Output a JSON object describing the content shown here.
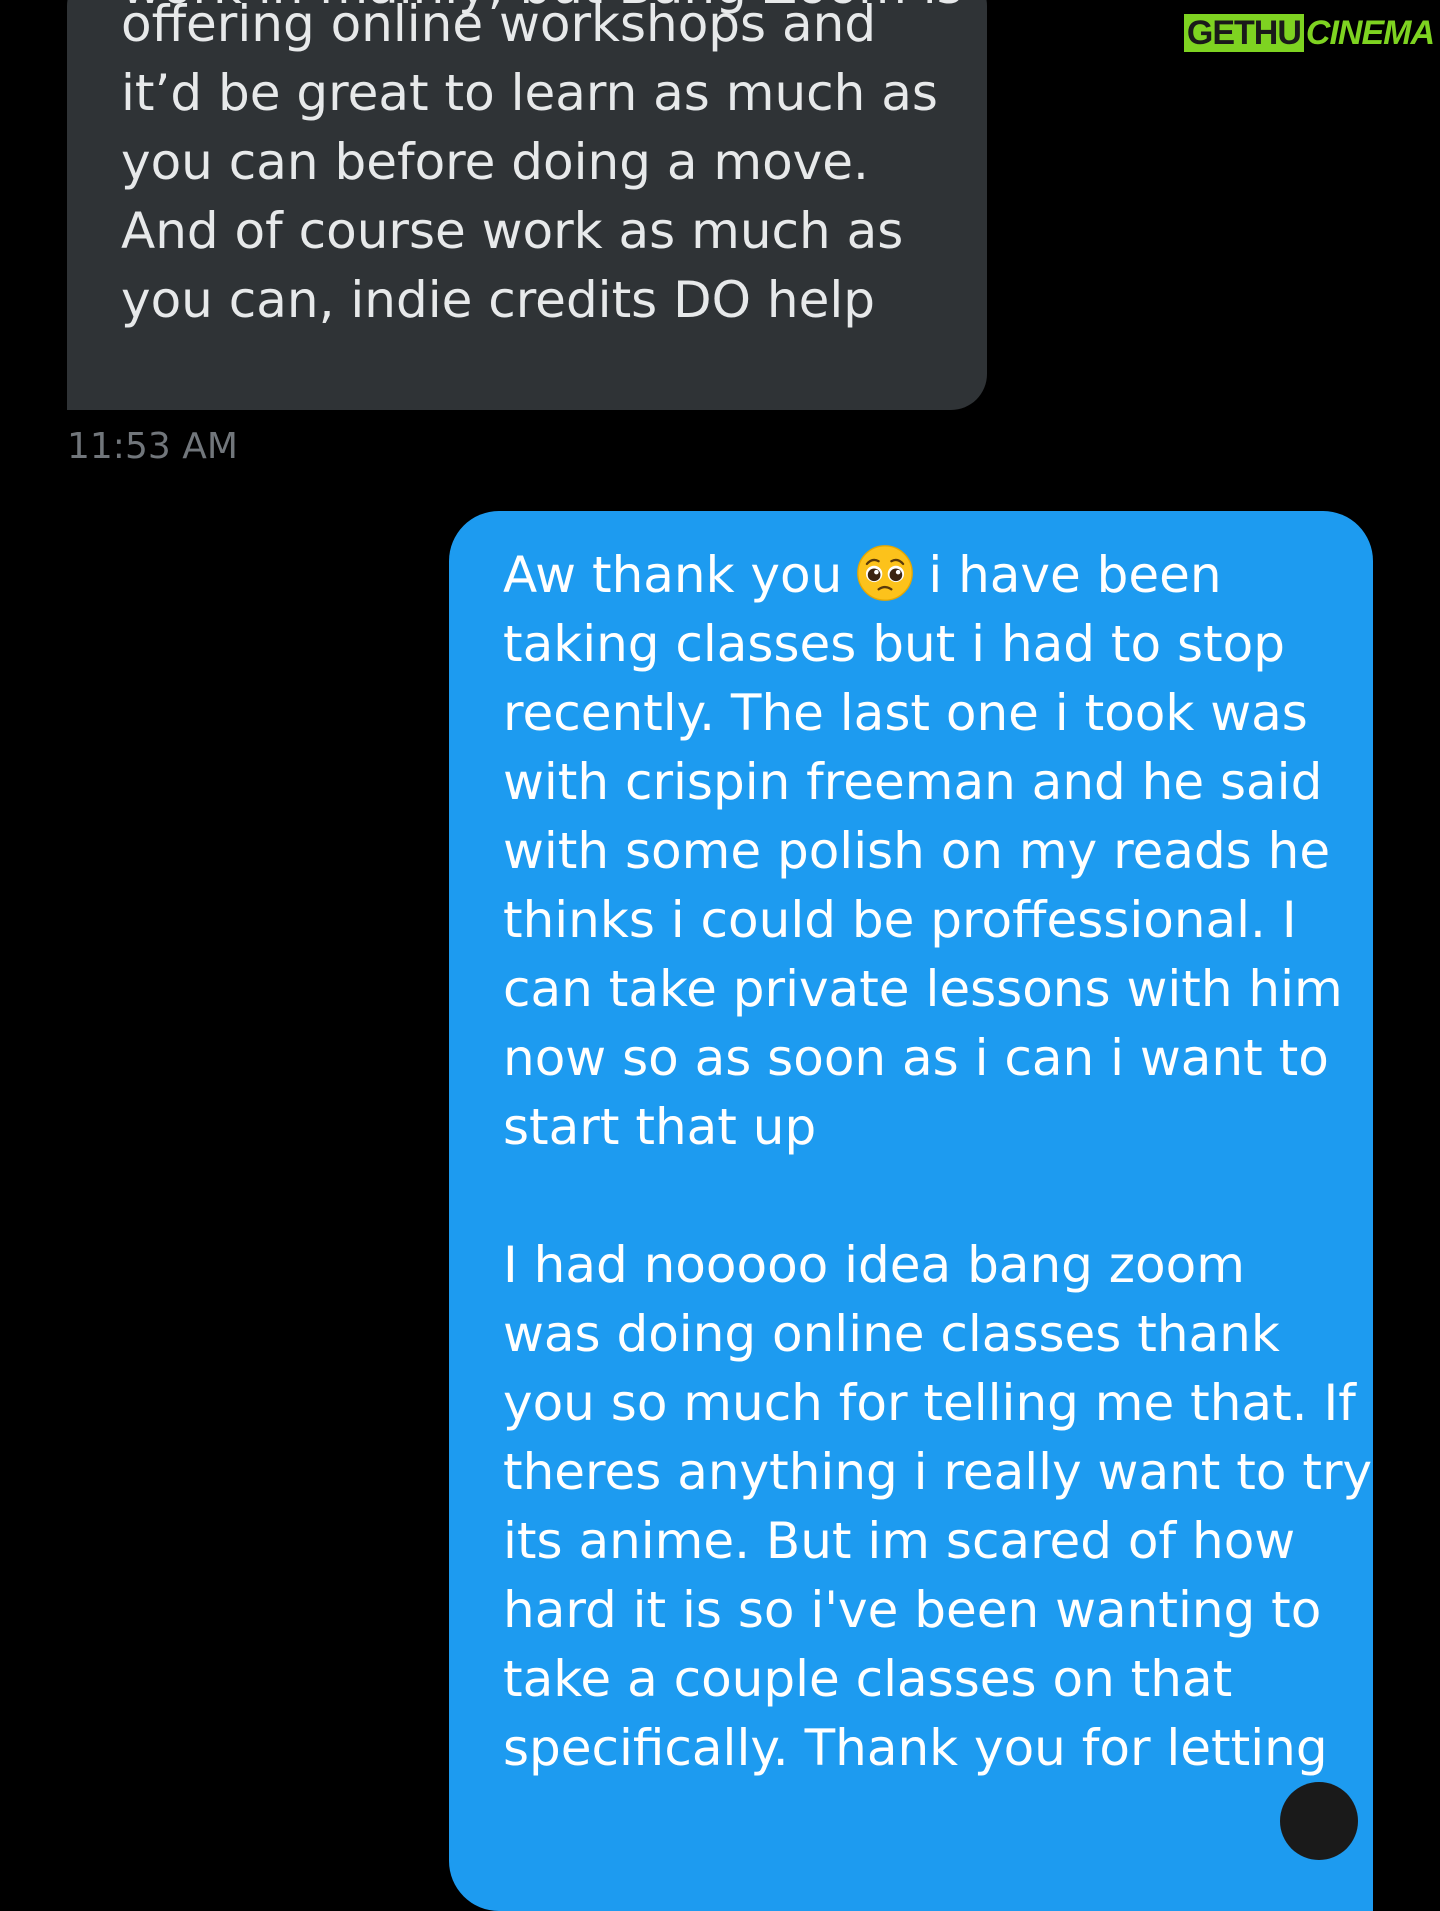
{
  "watermark": {
    "part1": "GETHU",
    "part2": "CINEMA"
  },
  "received_message": {
    "clipped_line": "work in mainly, but Bang Zoom is",
    "lines": [
      "offering online workshops and",
      "it’d be great to learn as much as",
      "you can before doing a move.",
      "And of course work as much as",
      "you can, indie credits DO help"
    ],
    "timestamp": "11:53 AM"
  },
  "sent_message": {
    "first_line_start": "Aw thank you",
    "first_line_emoji": "pleading-face-emoji",
    "first_line_end": "i have been",
    "lines_paragraph1": [
      "taking classes but i had to stop",
      "recently. The last one i took was",
      "with crispin freeman and he said",
      "with some polish on my reads he",
      "thinks i could be proffessional. I",
      "can take private lessons with him",
      "now so as soon as i can i want to",
      "start that up"
    ],
    "lines_paragraph2": [
      "I had nooooo idea bang zoom",
      "was doing online classes thank",
      "you so much for telling me that. If",
      "theres anything i really want to try",
      "its anime. But im scared of how",
      "hard it is so i've been wanting to",
      "take a couple classes on that",
      "specifically. Thank you for letting"
    ]
  },
  "colors": {
    "background": "#000000",
    "received_bubble": "#2f3336",
    "sent_bubble": "#1d9bf0",
    "timestamp": "#71767b",
    "watermark_accent": "#7ed321"
  }
}
